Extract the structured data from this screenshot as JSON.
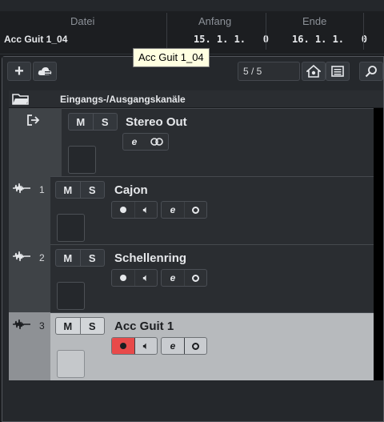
{
  "infoline": {
    "file_header": "Datei",
    "file_value": "Acc Guit 1_04",
    "start_header": "Anfang",
    "start_value": "15. 1. 1.   0",
    "end_header": "Ende",
    "end_value": "16. 1. 1.   0"
  },
  "tooltip": "Acc Guit 1_04",
  "toolbar": {
    "add_label": "+",
    "counter": "5 / 5"
  },
  "io_folder": {
    "label": "Eingangs-/Ausgangskanäle"
  },
  "tracks": [
    {
      "number": "",
      "name": "Stereo Out",
      "mute": "M",
      "solo": "S",
      "selected": false,
      "type": "output"
    },
    {
      "number": "1",
      "name": "Cajon",
      "mute": "M",
      "solo": "S",
      "selected": false,
      "type": "audio"
    },
    {
      "number": "2",
      "name": "Schellenring",
      "mute": "M",
      "solo": "S",
      "selected": false,
      "type": "audio"
    },
    {
      "number": "3",
      "name": "Acc Guit 1",
      "mute": "M",
      "solo": "S",
      "selected": true,
      "type": "audio"
    }
  ],
  "colors": {
    "record_active": "#e84a4a",
    "selected_track": "#b7babd",
    "background": "#1b1d20"
  }
}
